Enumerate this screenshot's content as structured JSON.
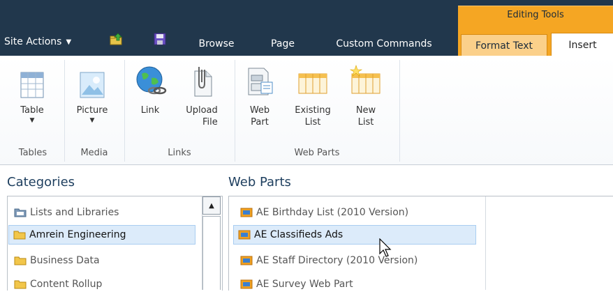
{
  "topbar": {
    "site_actions_label": "Site Actions",
    "contextual_group": "Editing Tools",
    "tabs": [
      {
        "label": "Browse"
      },
      {
        "label": "Page"
      },
      {
        "label": "Custom Commands"
      },
      {
        "label": "Format Text"
      },
      {
        "label": "Insert"
      }
    ]
  },
  "ribbon": {
    "buttons": {
      "table": {
        "label": "Table"
      },
      "picture": {
        "label": "Picture"
      },
      "link": {
        "label": "Link"
      },
      "upload_file": {
        "line1": "Upload",
        "line2": "File"
      },
      "web_part": {
        "line1": "Web",
        "line2": "Part"
      },
      "existing_list": {
        "line1": "Existing",
        "line2": "List"
      },
      "new_list": {
        "line1": "New",
        "line2": "List"
      }
    },
    "groups": {
      "tables": "Tables",
      "media": "Media",
      "links": "Links",
      "web_parts": "Web Parts"
    }
  },
  "categories": {
    "title": "Categories",
    "items": [
      {
        "label": "Lists and Libraries"
      },
      {
        "label": "Amrein Engineering"
      },
      {
        "label": "Business Data"
      },
      {
        "label": "Content Rollup"
      }
    ]
  },
  "web_parts": {
    "title": "Web Parts",
    "items": [
      {
        "label": "AE Birthday List (2010 Version)"
      },
      {
        "label": "AE Classifieds Ads"
      },
      {
        "label": "AE Staff Directory (2010 Version)"
      },
      {
        "label": "AE Survey Web Part"
      }
    ]
  },
  "colors": {
    "topbar_bg": "#21374c",
    "contextual_orange": "#f5a623",
    "selection_bg": "#dcebfa",
    "title_blue": "#1d3e5e"
  }
}
